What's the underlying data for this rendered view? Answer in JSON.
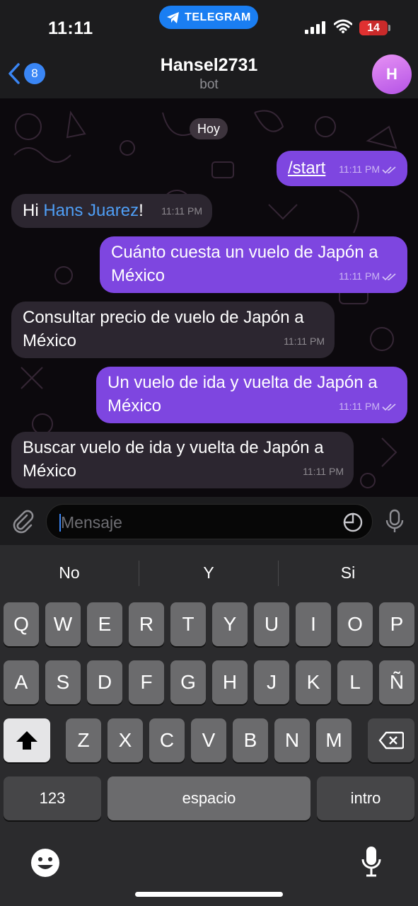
{
  "status_bar": {
    "time": "11:11",
    "app_pill": "TELEGRAM",
    "battery": "14"
  },
  "header": {
    "back_count": "8",
    "title": "Hansel2731",
    "subtitle": "bot",
    "avatar_initial": "H"
  },
  "chat": {
    "date_chip": "Hoy",
    "messages": [
      {
        "direction": "out",
        "text": "/start",
        "time": "11:11 PM",
        "read": true
      },
      {
        "direction": "in",
        "prefix": "Hi ",
        "mention": "Hans Juarez",
        "suffix": "!",
        "time": "11:11 PM"
      },
      {
        "direction": "out",
        "line1": "Cuánto cuesta un vuelo de Japón a",
        "line2": "México",
        "time": "11:11 PM",
        "read": true
      },
      {
        "direction": "in",
        "line1": "Consultar precio de vuelo de Japón a",
        "line2": "México",
        "time": "11:11 PM"
      },
      {
        "direction": "out",
        "line1": "Un vuelo de ida y vuelta de Japón a",
        "line2": "México",
        "time": "11:11 PM",
        "read": true
      },
      {
        "direction": "in",
        "line1": "Buscar vuelo de ida y vuelta de Japón a",
        "line2": "México",
        "time": "11:11 PM"
      }
    ]
  },
  "composer": {
    "placeholder": "Mensaje"
  },
  "keyboard": {
    "suggestions": [
      "No",
      "Y",
      "Si"
    ],
    "row1": [
      "Q",
      "W",
      "E",
      "R",
      "T",
      "Y",
      "U",
      "I",
      "O",
      "P"
    ],
    "row2": [
      "A",
      "S",
      "D",
      "F",
      "G",
      "H",
      "J",
      "K",
      "L",
      "Ñ"
    ],
    "row3": [
      "Z",
      "X",
      "C",
      "V",
      "B",
      "N",
      "M"
    ],
    "numbers_label": "123",
    "space_label": "espacio",
    "return_label": "intro"
  },
  "colors": {
    "outgoing_bubble": "#7e46e0",
    "incoming_bubble": "#2c2630",
    "mention_link": "#4f9ef5",
    "telegram_blue": "#1a7ef2"
  }
}
